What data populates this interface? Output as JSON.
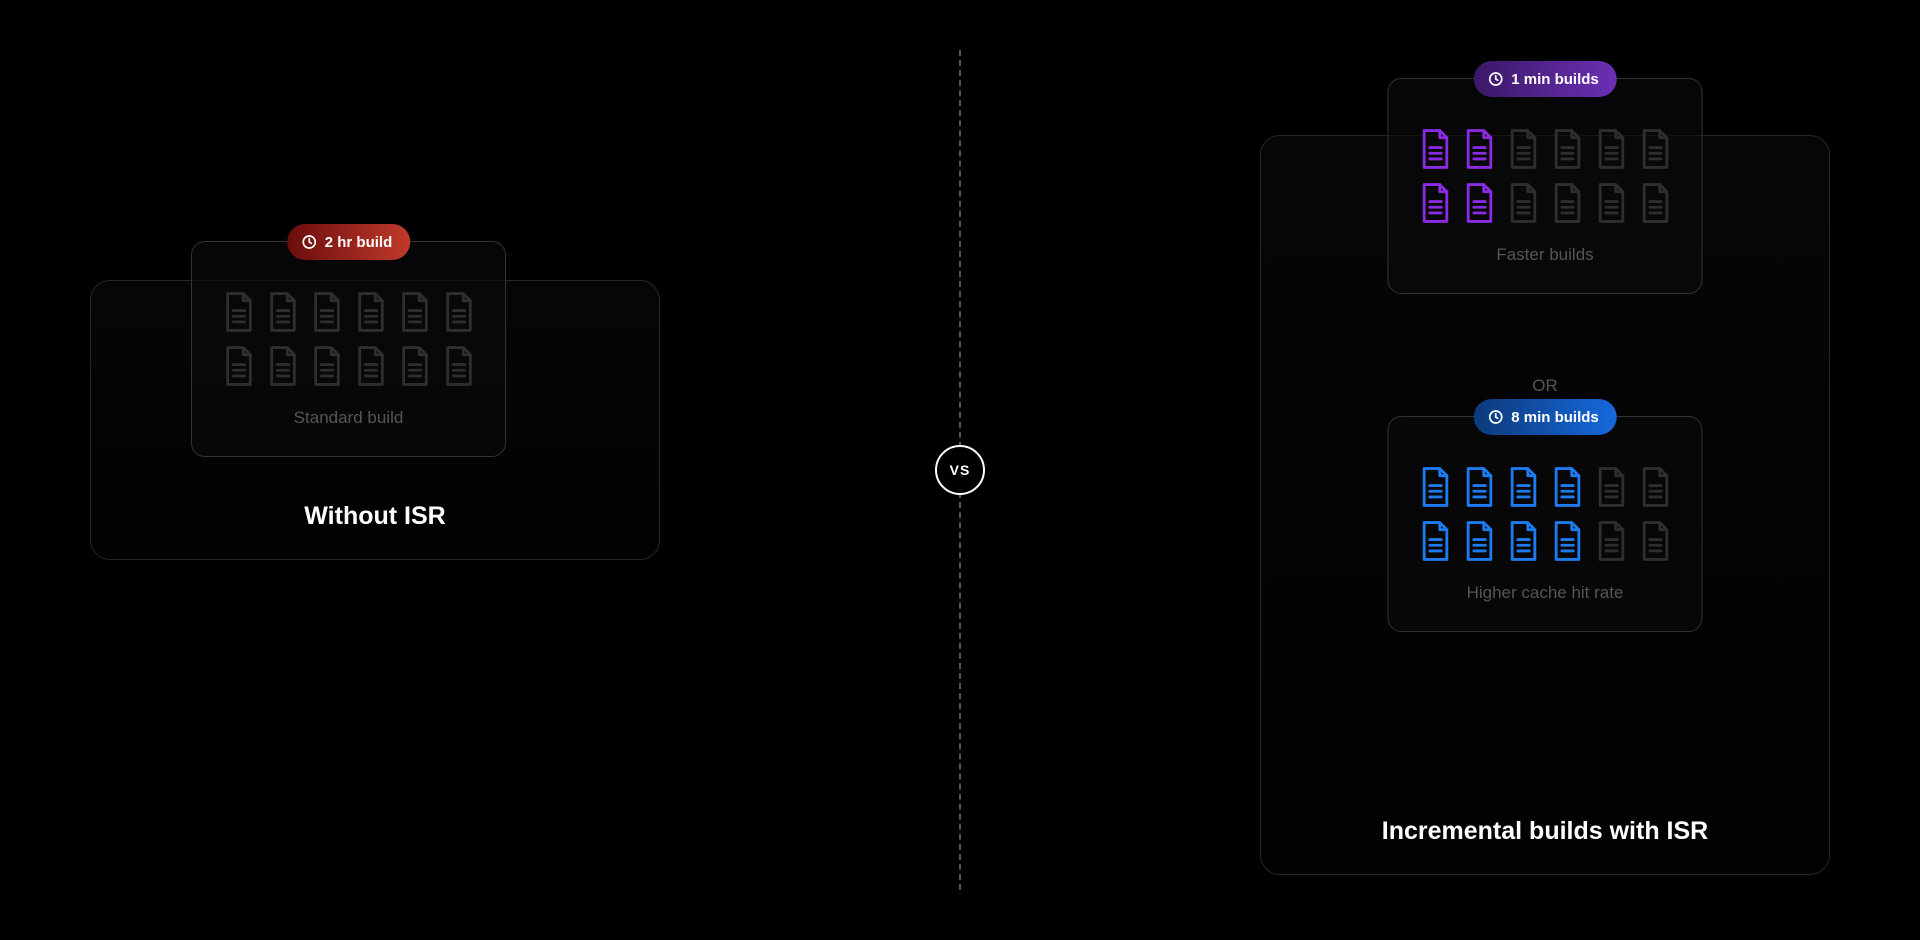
{
  "vs_label": "VS",
  "left": {
    "outer_title": "Without ISR",
    "panel": {
      "pill_label": "2 hr build",
      "caption": "Standard build",
      "doc_colors": [
        "dim",
        "dim",
        "dim",
        "dim",
        "dim",
        "dim",
        "dim",
        "dim",
        "dim",
        "dim",
        "dim",
        "dim"
      ]
    }
  },
  "right": {
    "outer_title": "Incremental builds with ISR",
    "or_label": "OR",
    "panel_top": {
      "pill_label": "1 min builds",
      "caption": "Faster builds",
      "doc_colors": [
        "purple",
        "purple",
        "dim",
        "dim",
        "dim",
        "dim",
        "purple",
        "purple",
        "dim",
        "dim",
        "dim",
        "dim"
      ]
    },
    "panel_bottom": {
      "pill_label": "8 min builds",
      "caption": "Higher cache hit rate",
      "doc_colors": [
        "blue",
        "blue",
        "blue",
        "blue",
        "dim",
        "dim",
        "blue",
        "blue",
        "blue",
        "blue",
        "dim",
        "dim"
      ]
    }
  },
  "colors": {
    "dim": "#2e2e2e",
    "purple": "#8a2be2",
    "blue": "#1e7bef"
  }
}
